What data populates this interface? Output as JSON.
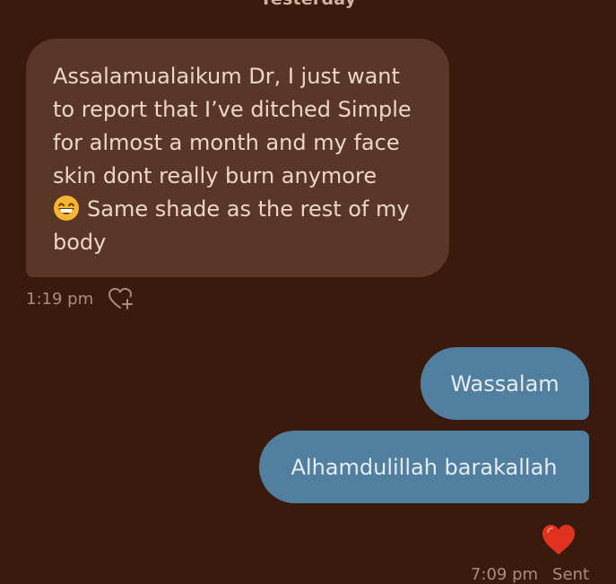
{
  "date_header": "Yesterday",
  "messages": {
    "incoming": {
      "line1": "Assalamualaikum Dr, I just want",
      "line2": "to report that I’ve ditched Simple",
      "line3": "for almost a month and my face",
      "line4": "skin dont really burn anymore",
      "line5": "Same shade as the rest of my",
      "line6": "body",
      "emoji": "grinning-face-icon",
      "time": "1:19 pm",
      "react_icon": "heart-plus-icon"
    },
    "outgoing": [
      {
        "text": "Wassalam"
      },
      {
        "text": "Alhamdulillah barakallah"
      }
    ],
    "reaction": "heart-icon",
    "outgoing_time": "7:09 pm",
    "outgoing_status": "Sent"
  },
  "colors": {
    "background": "#3a1a0c",
    "incoming_bubble": "#5a3626",
    "outgoing_bubble": "#517f9f",
    "heart": "#e0321f"
  }
}
